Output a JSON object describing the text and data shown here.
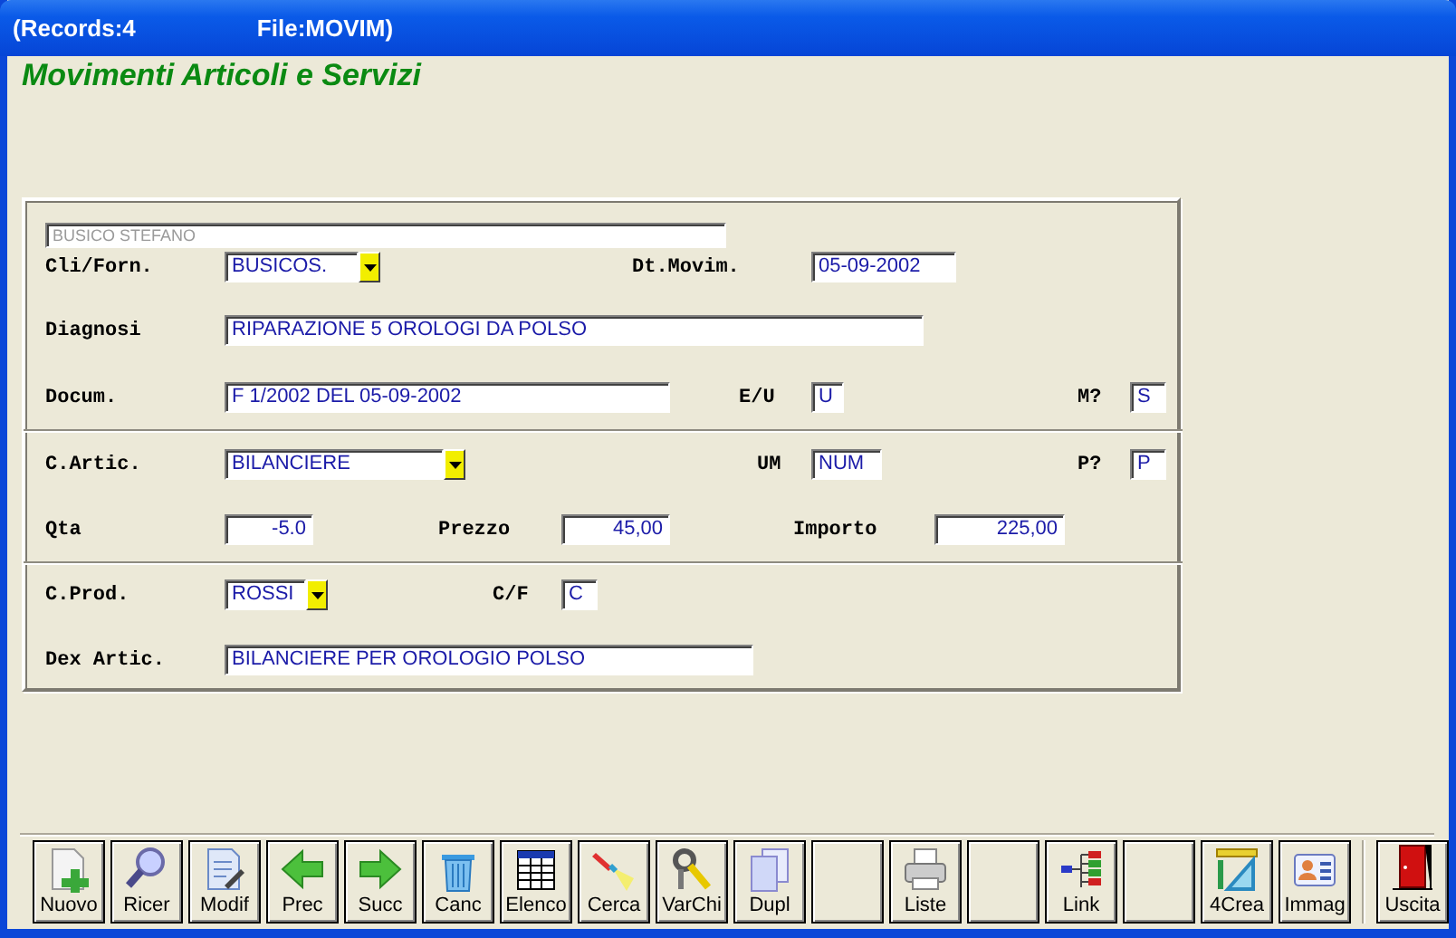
{
  "window": {
    "title_left": "(Records:4",
    "title_right": "File:MOVIM)"
  },
  "heading": "Movimenti Articoli e Servizi",
  "form": {
    "rows": [
      {
        "kind": "fields",
        "fields": [
          {
            "kind": "readonly",
            "value": "BUSICO STEFANO"
          }
        ]
      },
      {
        "kind": "fields",
        "fields": [
          {
            "kind": "combo",
            "label": "Cli/Forn.",
            "value": "BUSICOS."
          },
          {
            "kind": "text",
            "label": "Dt.Movim.",
            "value": "05-09-2002"
          }
        ]
      },
      {
        "kind": "fields",
        "fields": [
          {
            "kind": "text",
            "label": "Diagnosi",
            "value": "RIPARAZIONE 5 OROLOGI DA POLSO"
          }
        ]
      },
      {
        "kind": "fields",
        "fields": [
          {
            "kind": "text",
            "label": "Docum.",
            "value": "F 1/2002 DEL 05-09-2002"
          },
          {
            "kind": "text",
            "label": "E/U",
            "value": "U"
          },
          {
            "kind": "text",
            "label": "M?",
            "value": "S"
          }
        ]
      },
      {
        "kind": "divider"
      },
      {
        "kind": "fields",
        "fields": [
          {
            "kind": "combo",
            "label": "C.Artic.",
            "value": "BILANCIERE"
          },
          {
            "kind": "text",
            "label": "UM",
            "value": "NUM"
          },
          {
            "kind": "text",
            "label": "P?",
            "value": "P"
          }
        ]
      },
      {
        "kind": "fields",
        "fields": [
          {
            "kind": "number",
            "label": "Qta",
            "value": "-5.0"
          },
          {
            "kind": "number",
            "label": "Prezzo",
            "value": "45,00"
          },
          {
            "kind": "number",
            "label": "Importo",
            "value": "225,00"
          }
        ]
      },
      {
        "kind": "divider"
      },
      {
        "kind": "fields",
        "fields": [
          {
            "kind": "combo",
            "label": "C.Prod.",
            "value": "ROSSI"
          },
          {
            "kind": "text",
            "label": "C/F",
            "value": "C"
          }
        ]
      },
      {
        "kind": "fields",
        "fields": [
          {
            "kind": "text",
            "label": "Dex Artic.",
            "value": "BILANCIERE PER OROLOGIO POLSO"
          }
        ]
      }
    ]
  },
  "toolbar": [
    {
      "kind": "button",
      "label": "Nuovo"
    },
    {
      "kind": "button",
      "label": "Ricer"
    },
    {
      "kind": "button",
      "label": "Modif"
    },
    {
      "kind": "button",
      "label": "Prec"
    },
    {
      "kind": "button",
      "label": "Succ"
    },
    {
      "kind": "button",
      "label": "Canc"
    },
    {
      "kind": "button",
      "label": "Elenco"
    },
    {
      "kind": "button",
      "label": "Cerca"
    },
    {
      "kind": "button",
      "label": "VarChi"
    },
    {
      "kind": "button",
      "label": "Dupl"
    },
    {
      "kind": "blank"
    },
    {
      "kind": "button",
      "label": "Liste"
    },
    {
      "kind": "blank"
    },
    {
      "kind": "button",
      "label": "Link"
    },
    {
      "kind": "blank"
    },
    {
      "kind": "button",
      "label": "4Crea"
    },
    {
      "kind": "button",
      "label": "Immag"
    },
    {
      "kind": "separator"
    },
    {
      "kind": "button",
      "label": "Uscita"
    }
  ]
}
